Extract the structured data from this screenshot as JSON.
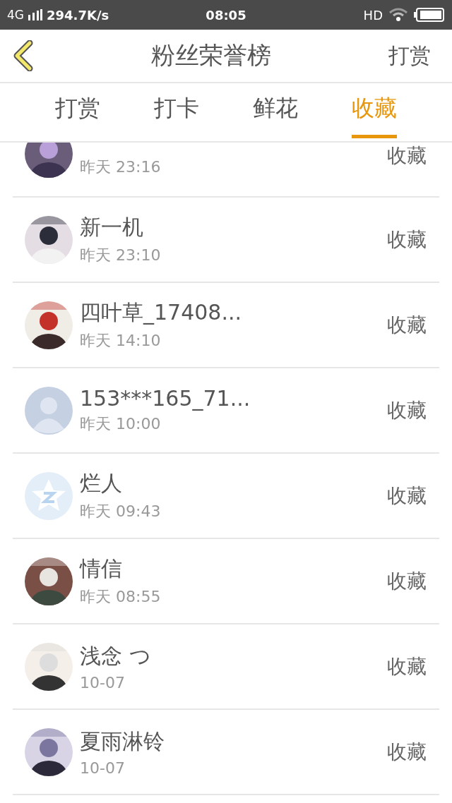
{
  "status_bar": {
    "network": "4G",
    "speed": "294.7K/s",
    "time": "08:05",
    "hd": "HD"
  },
  "header": {
    "title": "粉丝荣誉榜",
    "action": "打赏"
  },
  "tabs": [
    {
      "label": "打赏",
      "selected": false
    },
    {
      "label": "打卡",
      "selected": false
    },
    {
      "label": "鲜花",
      "selected": false
    },
    {
      "label": "收藏",
      "selected": true
    }
  ],
  "rows": [
    {
      "time": "昨天 23:16",
      "action": "收藏"
    },
    {
      "name": "新一机",
      "time": "昨天 23:10",
      "action": "收藏"
    },
    {
      "name": "四叶草_17408...",
      "time": "昨天 14:10",
      "action": "收藏"
    },
    {
      "avatar": {
        "kind": "default"
      },
      "name": "153***165_71...",
      "time": "昨天 10:00",
      "action": "收藏"
    },
    {
      "avatar": {
        "kind": "star"
      },
      "name": "烂人",
      "time": "昨天 09:43",
      "action": "收藏"
    },
    {
      "name": "情信",
      "time": "昨天 08:55",
      "action": "收藏"
    },
    {
      "name": "浅念 つ",
      "time": "10-07",
      "action": "收藏"
    },
    {
      "name": "夏雨淋铃",
      "time": "10-07",
      "action": "收藏"
    }
  ]
}
